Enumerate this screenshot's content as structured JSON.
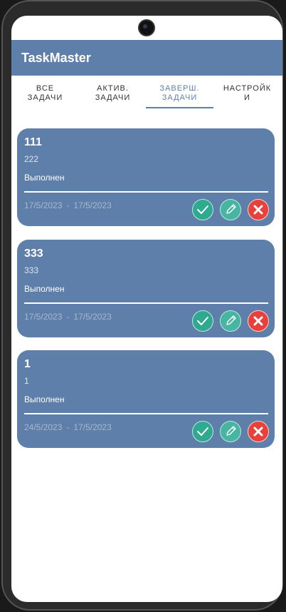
{
  "app": {
    "title": "TaskMaster"
  },
  "tabs": [
    {
      "line1": "ВСЕ",
      "line2": "ЗАДАЧИ"
    },
    {
      "line1": "АКТИВ.",
      "line2": "ЗАДАЧИ"
    },
    {
      "line1": "ЗАВЕРШ.",
      "line2": "ЗАДАЧИ"
    },
    {
      "line1": "НАСТРОЙК",
      "line2": "И"
    }
  ],
  "active_tab_index": 2,
  "tasks": [
    {
      "title": "111",
      "description": "222",
      "status": "Выполнен",
      "start": "17/5/2023",
      "separator": "-",
      "end": "17/5/2023"
    },
    {
      "title": "333",
      "description": "333",
      "status": "Выполнен",
      "start": "17/5/2023",
      "separator": "-",
      "end": "17/5/2023"
    },
    {
      "title": "1",
      "description": "1",
      "status": "Выполнен",
      "start": "24/5/2023",
      "separator": "-",
      "end": "17/5/2023"
    }
  ],
  "icons": {
    "complete": "check-icon",
    "edit": "pencil-icon",
    "delete": "close-icon"
  },
  "colors": {
    "primary": "#5f7fab",
    "complete": "#2fa98f",
    "edit": "#47b5a2",
    "delete": "#e8413c"
  }
}
